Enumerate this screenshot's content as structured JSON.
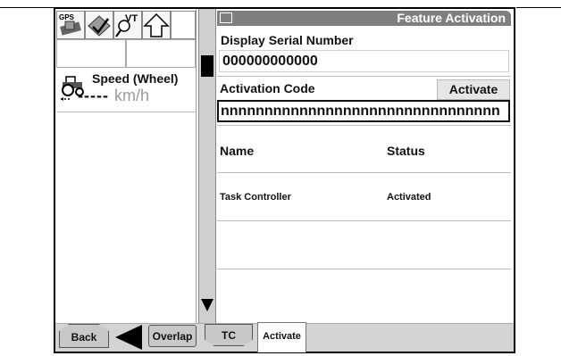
{
  "window": {
    "title": "Feature Activation"
  },
  "left_panel": {
    "icons": [
      "gps-icon",
      "guidance-icon",
      "vt-icon",
      "up-arrow-icon"
    ],
    "gps_label": "GPS",
    "vt_label": "VT",
    "speed": {
      "label": "Speed (Wheel)",
      "value": "-----",
      "unit": "km/h"
    }
  },
  "serial": {
    "label": "Display Serial Number",
    "value": "000000000000"
  },
  "activation": {
    "label": "Activation Code",
    "value": "nnnnnnnnnnnnnnnnnnnnnnnnnnnnnnnn",
    "button": "Activate"
  },
  "table": {
    "columns": [
      "Name",
      "Status"
    ],
    "rows": [
      {
        "name": "Task Controller",
        "status": "Activated"
      }
    ]
  },
  "softkeys": {
    "back": "Back",
    "overlap": "Overlap",
    "tc": "TC",
    "active_tab": "Activate"
  }
}
